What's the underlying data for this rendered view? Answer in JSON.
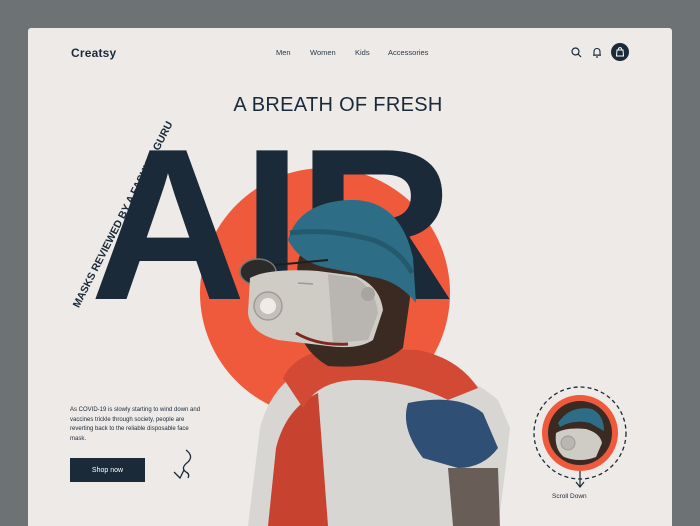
{
  "brand": {
    "logo": "Creatsy"
  },
  "nav": {
    "items": [
      "Men",
      "Women",
      "Kids",
      "Accessories"
    ]
  },
  "icons": {
    "search": "search-icon",
    "notifications": "bell-icon",
    "cart": "shopping-bag-icon"
  },
  "hero": {
    "headline": "A BREATH OF FRESH",
    "big_word": "AIR",
    "vertical_tagline": "MASKS REVIEWED BY A FASHION GURU",
    "description": "As COVID-19 is slowly starting to wind down and vaccines trickle through society, people are reverting back to the reliable disposable face mask.",
    "cta": "Shop now",
    "scroll_label": "Scroll Down"
  },
  "colors": {
    "accent": "#ef5a3c",
    "navy": "#1b2a38",
    "background": "#edeae7",
    "frame": "#6d7274"
  }
}
